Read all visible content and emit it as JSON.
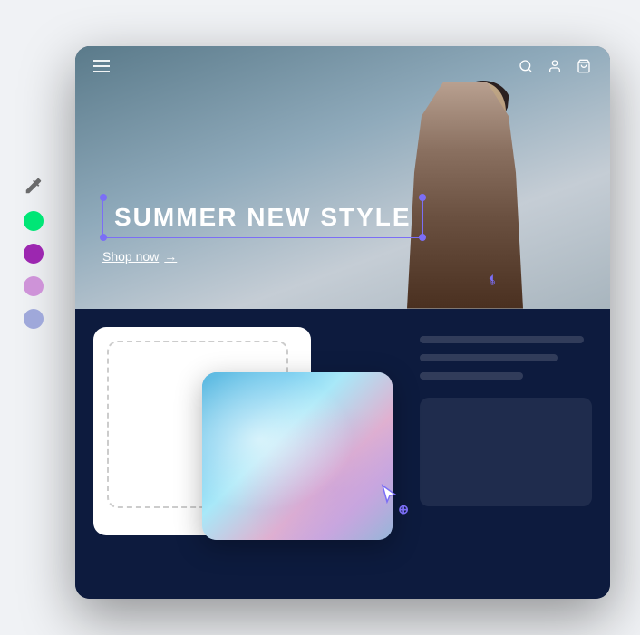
{
  "palette": {
    "swatches": [
      {
        "id": "green",
        "color": "#00e676"
      },
      {
        "id": "purple",
        "color": "#9c27b0"
      },
      {
        "id": "lavender",
        "color": "#ce93d8"
      },
      {
        "id": "periwinkle",
        "color": "#9fa8da"
      }
    ]
  },
  "navbar": {
    "search_label": "search",
    "user_label": "user",
    "cart_label": "cart"
  },
  "hero": {
    "title": "SUMMER NEW STYLE",
    "cta_label": "Shop now",
    "cta_arrow": "→"
  },
  "bottom": {
    "lines": [
      "long",
      "medium",
      "short"
    ]
  }
}
